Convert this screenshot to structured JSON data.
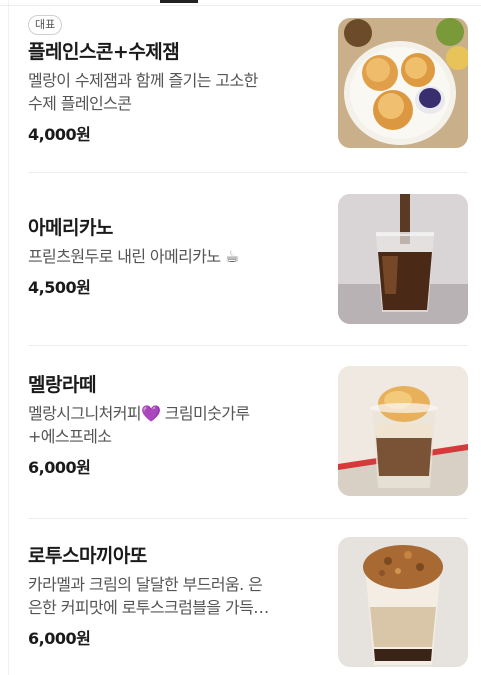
{
  "items": [
    {
      "badge": "대표",
      "name": "플레인스콘+수제잼",
      "description": "멜랑이 수제잼과 함께 즐기는 고소한\n수제 플레인스콘",
      "price": "4,000원"
    },
    {
      "name": "아메리카노",
      "description": "프릳츠원두로 내린 아메리카노 ☕",
      "price": "4,500원"
    },
    {
      "name": "멜랑라떼",
      "description": "멜랑시그니처커피💜 크림미숫가루\n+에스프레소",
      "price": "6,000원"
    },
    {
      "name": "로투스마끼아또",
      "description": "카라멜과 크림의 달달한 부드러움. 은\n은한 커피맛에 로투스크럼블을 가득…",
      "price": "6,000원"
    }
  ],
  "colors": {
    "text_primary": "#1a1a1a",
    "text_secondary": "#555555",
    "divider": "#ededed"
  },
  "icons": [
    "coffee-cup-icon",
    "purple-heart-icon"
  ]
}
